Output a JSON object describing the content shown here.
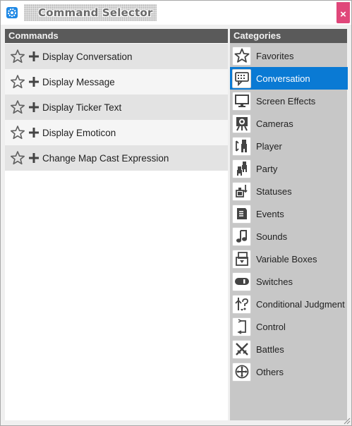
{
  "window": {
    "title": "Command Selector",
    "close_label": "×"
  },
  "commands": {
    "header": "Commands",
    "items": [
      {
        "label": "Display Conversation"
      },
      {
        "label": "Display Message"
      },
      {
        "label": "Display Ticker Text"
      },
      {
        "label": "Display Emoticon"
      },
      {
        "label": "Change Map Cast Expression"
      }
    ],
    "item_icons": [
      "star-outline-icon",
      "plus-icon"
    ]
  },
  "categories": {
    "header": "Categories",
    "selected": "Conversation",
    "items": [
      {
        "label": "Favorites",
        "icon": "star-icon"
      },
      {
        "label": "Conversation",
        "icon": "speech-bubble-icon"
      },
      {
        "label": "Screen Effects",
        "icon": "monitor-icon"
      },
      {
        "label": "Cameras",
        "icon": "camera-icon"
      },
      {
        "label": "Player",
        "icon": "player-icon"
      },
      {
        "label": "Party",
        "icon": "party-icon"
      },
      {
        "label": "Statuses",
        "icon": "status-icon"
      },
      {
        "label": "Events",
        "icon": "event-icon"
      },
      {
        "label": "Sounds",
        "icon": "music-note-icon"
      },
      {
        "label": "Variable Boxes",
        "icon": "variable-box-icon"
      },
      {
        "label": "Switches",
        "icon": "switch-icon"
      },
      {
        "label": "Conditional Judgment",
        "icon": "conditional-icon"
      },
      {
        "label": "Control",
        "icon": "control-icon"
      },
      {
        "label": "Battles",
        "icon": "crossed-swords-icon"
      },
      {
        "label": "Others",
        "icon": "others-icon"
      }
    ]
  },
  "colors": {
    "header_bg": "#5a5a5a",
    "selected_bg": "#0a7ad4",
    "close_bg": "#e0477a",
    "categories_bg": "#c7c7c7"
  }
}
